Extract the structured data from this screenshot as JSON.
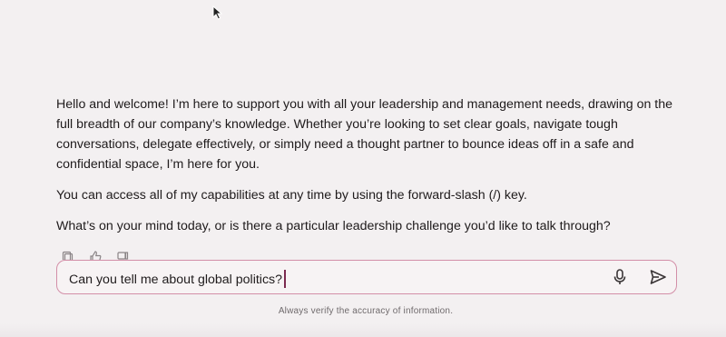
{
  "assistant_message": {
    "paragraphs": [
      "Hello and welcome! I’m here to support you with all your leadership and management needs, drawing on the full breadth of our company’s knowledge. Whether you’re looking to set clear goals, navigate tough conversations, delegate effectively, or simply need a thought partner to bounce ideas off in a safe and confidential space, I’m here for you.",
      "You can access all of my capabilities at any time by using the forward-slash (/) key.",
      "What’s on your mind today, or is there a particular leadership challenge you’d like to talk through?"
    ]
  },
  "message_actions": {
    "icons": [
      "copy-icon",
      "thumbs-up-icon",
      "thumbs-down-icon"
    ]
  },
  "composer": {
    "value": "Can you tell me about global politics?",
    "mic_icon": "microphone-icon",
    "send_icon": "send-icon",
    "accent_color": "#d38fa8"
  },
  "footer": {
    "disclaimer": "Always verify the accuracy of information."
  }
}
